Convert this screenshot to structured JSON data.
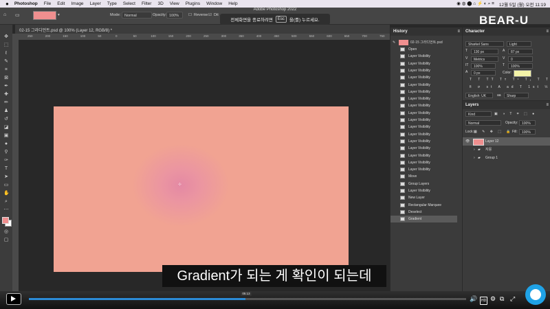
{
  "menubar": {
    "app": "Photoshop",
    "items": [
      "File",
      "Edit",
      "Image",
      "Layer",
      "Type",
      "Select",
      "Filter",
      "3D",
      "View",
      "Plugins",
      "Window",
      "Help"
    ],
    "clock": "12월 5일 (월) 오전 11:19"
  },
  "title": "Adobe Photoshop 2022",
  "toast": {
    "pre": "전체화면을 종료하려면",
    "key": "Esc",
    "post": "을(를) 누르세요."
  },
  "options": {
    "mode_label": "Mode:",
    "mode_value": "Normal",
    "opacity_label": "Opacity:",
    "opacity_value": "100%",
    "reverse": "Reverse",
    "dither": "Dit"
  },
  "doc_tab": "02-15 그라디언트.psd @ 100% (Layer 12, RGB/8) *",
  "ruler_ticks": [
    "250",
    "200",
    "150",
    "100",
    "50",
    "0",
    "50",
    "100",
    "150",
    "200",
    "250",
    "300",
    "350",
    "400",
    "450",
    "500",
    "550",
    "600",
    "650",
    "700",
    "750",
    "800",
    "850",
    "900",
    "950",
    "1000",
    "1050",
    "1100",
    "1150",
    "1200"
  ],
  "history": {
    "title": "History",
    "snapshot": "02-15 그라디언트.psd",
    "items": [
      "Open",
      "Layer Visibility",
      "Layer Visibility",
      "Layer Visibility",
      "Layer Visibility",
      "Layer Visibility",
      "Layer Visibility",
      "Layer Visibility",
      "Layer Visibility",
      "Layer Visibility",
      "Layer Visibility",
      "Layer Visibility",
      "Layer Visibility",
      "Layer Visibility",
      "Layer Visibility",
      "Layer Visibility",
      "Layer Visibility",
      "Layer Visibility",
      "Move",
      "Group Layers",
      "Layer Visibility",
      "New Layer",
      "Rectangular Marquee",
      "Deselect",
      "Gradient"
    ]
  },
  "character": {
    "title": "Character",
    "font": "Sharkel Sans",
    "style": "Light",
    "size": "130 px",
    "leading": "87 px",
    "kerning": "Metrics",
    "tracking": "0",
    "vscale": "100%",
    "hscale": "100%",
    "baseline": "0 px",
    "color_label": "Color:",
    "color": "#f3f3a8",
    "language": "English: UK",
    "aa_label": "aa",
    "antialias": "Sharp"
  },
  "layers": {
    "title": "Layers",
    "filter": "Kind",
    "blend": "Normal",
    "opacity_label": "Opacity:",
    "opacity": "100%",
    "lock_label": "Lock:",
    "fill_label": "Fill:",
    "fill": "100%",
    "rows": [
      {
        "name": "Layer 12"
      },
      {
        "name": "자몽"
      },
      {
        "name": "Group 1"
      }
    ]
  },
  "subtitle": "Gradient가 되는 게 확인이 되는데",
  "video": {
    "time": "05:13",
    "progress": 0.495,
    "settings_badge": "HD"
  },
  "brand": "BEAR-U",
  "colors": {
    "fg_swatch": "#ef8f8f",
    "bg_swatch": "#ffffff",
    "accent": "#2b8bd6"
  }
}
